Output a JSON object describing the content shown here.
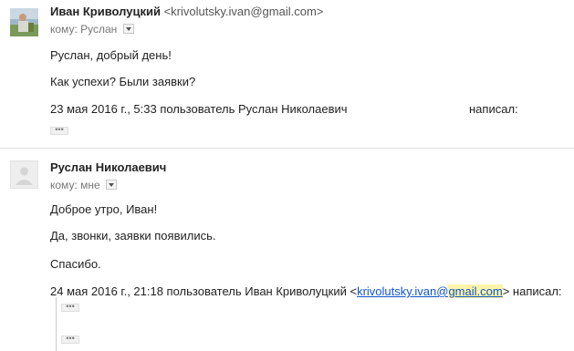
{
  "message1": {
    "sender_name": "Иван Криволуцкий",
    "sender_email": "<krivolutsky.ivan@gmail.com>",
    "to_label": "кому:",
    "to_value": "Руслан",
    "lines": [
      "Руслан, добрый день!",
      "Как успехи? Были заявки?",
      "23 мая 2016 г., 5:33 пользователь Руслан Николаевич",
      "написал:"
    ],
    "trimmed_label": "•••"
  },
  "message2": {
    "sender_name": "Руслан Николаевич",
    "to_label": "кому:",
    "to_value": "мне",
    "lines": [
      "Доброе утро, Иван!",
      "Да, звонки, заявки появились.",
      "Спасибо."
    ],
    "quote_header": {
      "prefix": "24 мая 2016 г., 21:18 пользователь Иван Криволуцкий <",
      "email_part1": "krivolutsky.ivan@",
      "email_part2": "gmail.com",
      "suffix": "> написал:"
    },
    "trimmed_label": "•••"
  }
}
